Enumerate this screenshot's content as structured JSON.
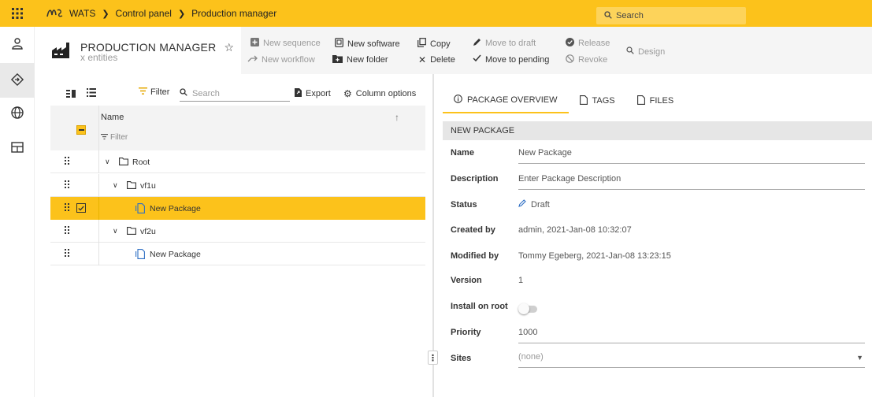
{
  "breadcrumb": {
    "app": "WATS",
    "items": [
      "Control panel",
      "Production manager"
    ]
  },
  "top_search": {
    "placeholder": "Search"
  },
  "header": {
    "title": "PRODUCTION MANAGER",
    "subtitle": "x entities"
  },
  "toolbar": {
    "new_sequence": "New sequence",
    "new_workflow": "New workflow",
    "new_software": "New software",
    "new_folder": "New folder",
    "copy": "Copy",
    "delete": "Delete",
    "move_to_draft": "Move to draft",
    "move_to_pending": "Move to pending",
    "release": "Release",
    "revoke": "Revoke",
    "design": "Design"
  },
  "left_tools": {
    "filter": "Filter",
    "search_placeholder": "Search",
    "export": "Export",
    "column_options": "Column options"
  },
  "table": {
    "column_name": "Name",
    "filter_row": "Filter",
    "rows": [
      {
        "label": "Root"
      },
      {
        "label": "vf1u"
      },
      {
        "label": "New Package"
      },
      {
        "label": "vf2u"
      },
      {
        "label": "New Package"
      }
    ]
  },
  "tabs": [
    "PACKAGE OVERVIEW",
    "TAGS",
    "FILES"
  ],
  "package": {
    "section_title": "NEW PACKAGE",
    "fields": {
      "name": {
        "label": "Name",
        "value": "New Package"
      },
      "description": {
        "label": "Description",
        "value": "Enter Package Description"
      },
      "status": {
        "label": "Status",
        "value": "Draft"
      },
      "created_by": {
        "label": "Created by",
        "value": "admin, 2021-Jan-08 10:32:07"
      },
      "modified_by": {
        "label": "Modified by",
        "value": "Tommy Egeberg, 2021-Jan-08 13:23:15"
      },
      "version": {
        "label": "Version",
        "value": "1"
      },
      "install_on_root": {
        "label": "Install on root",
        "value": false
      },
      "priority": {
        "label": "Priority",
        "value": "1000"
      },
      "sites": {
        "label": "Sites",
        "value": "(none)"
      }
    }
  },
  "colors": {
    "accent": "#fcc21b",
    "header_bg": "#f5f5f5",
    "section_bg": "#e6e6e6",
    "link_blue": "#2f6fc4"
  }
}
